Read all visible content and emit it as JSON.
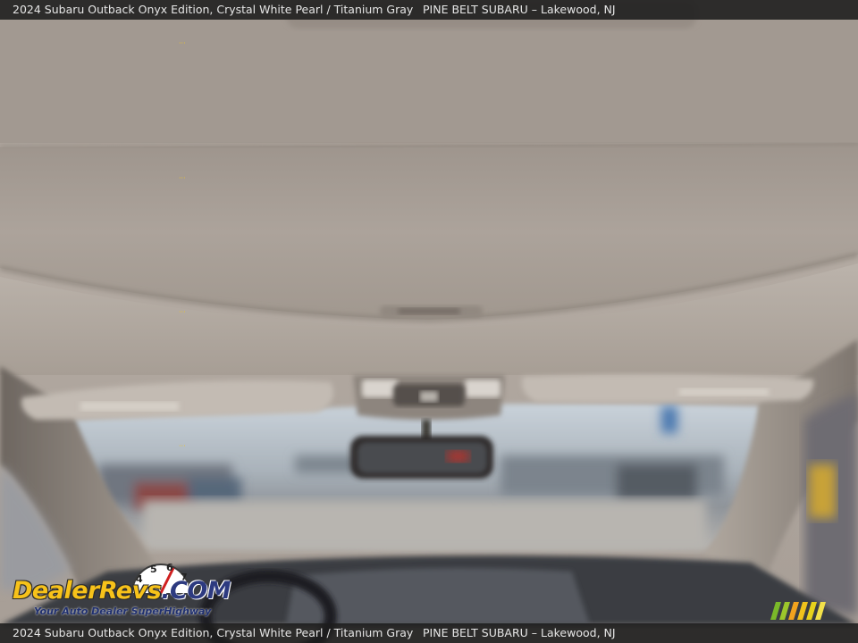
{
  "caption": {
    "vehicle": "2024 Subaru Outback Onyx Edition,  Crystal White Pearl / Titanium Gray",
    "dealer": "PINE BELT SUBARU – Lakewood, NJ"
  },
  "watermark": {
    "brand_main": "DealerRevs",
    "brand_suffix": ".COM",
    "tagline": "Your Auto Dealer SuperHighway",
    "gauge_numbers": [
      "4",
      "5",
      "6",
      "7"
    ]
  },
  "colors": {
    "headliner": "#b9b0a8",
    "caption_bg": "#1c1c1c",
    "logo_orange": "#f29a1e",
    "logo_yellow": "#f7c21a",
    "logo_blue": "#203070"
  },
  "icons": [
    "speedometer-gauge-icon",
    "color-stripes-icon"
  ]
}
